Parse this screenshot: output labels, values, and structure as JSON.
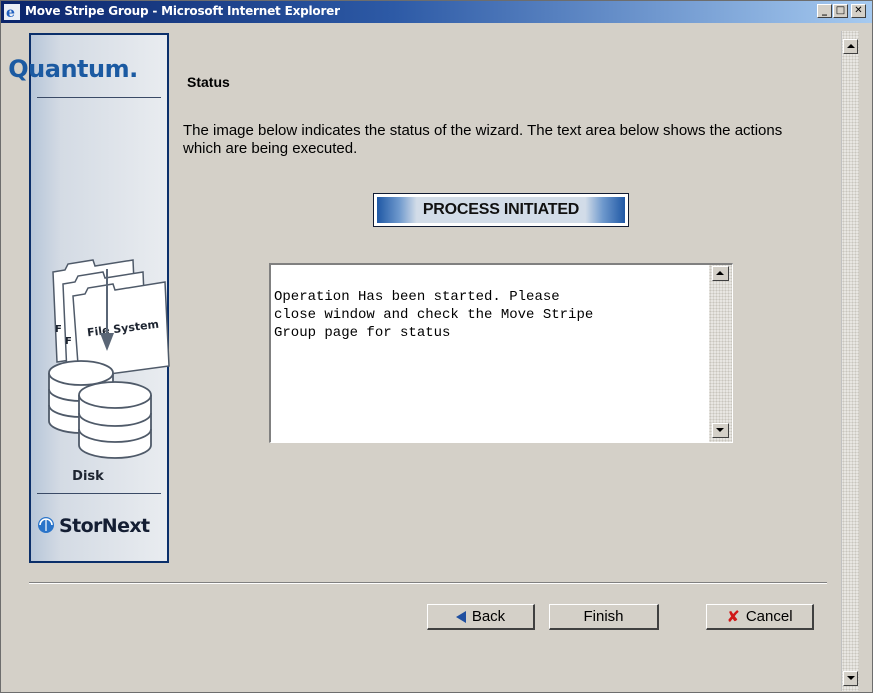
{
  "window": {
    "title": "Move Stripe Group - Microsoft Internet Explorer",
    "minimize_glyph": "_",
    "maximize_glyph": "□",
    "close_glyph": "✕"
  },
  "side_panel": {
    "brand_top": "Quantum.",
    "folder_label": "File System",
    "disk_label": "Disk",
    "brand_bottom": "StorNext"
  },
  "content": {
    "heading": "Status",
    "description": "The image below indicates the status of the wizard. The text area below shows the actions which are being executed.",
    "status_banner": "PROCESS INITIATED",
    "log_text": "Operation Has been started. Please\nclose window and check the Move Stripe\nGroup page for status"
  },
  "buttons": {
    "back": "Back",
    "finish": "Finish",
    "cancel": "Cancel"
  },
  "colors": {
    "title_bar": "#0a246a",
    "brand_blue": "#1b5aa2",
    "panel_border": "#0b2f6a",
    "cancel_icon": "#d01818"
  }
}
